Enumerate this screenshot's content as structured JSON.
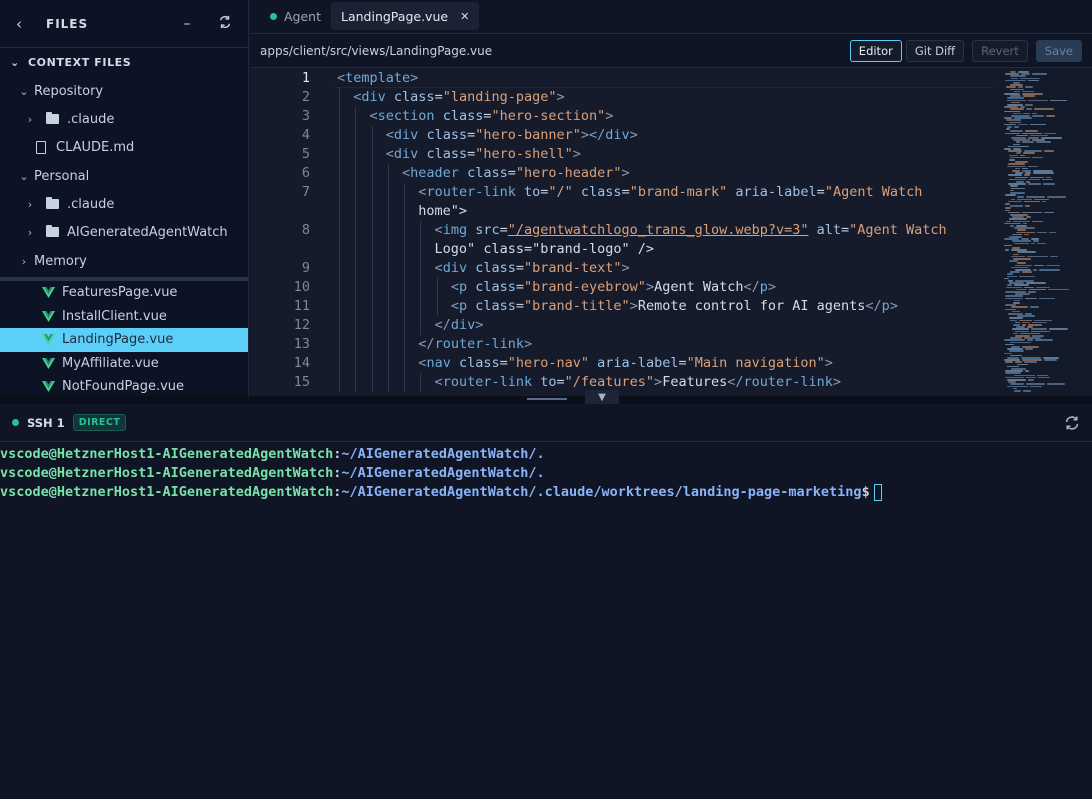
{
  "sidebar": {
    "title": "FILES",
    "back_icon": "chevron-left-icon",
    "collapse_icon": "minus-icon",
    "refresh_icon": "refresh-icon",
    "context_files_label": "CONTEXT FILES",
    "repository_label": "Repository",
    "repository_items": [
      {
        "type": "folder",
        "label": ".claude"
      },
      {
        "type": "file",
        "label": "CLAUDE.md"
      }
    ],
    "personal_label": "Personal",
    "personal_items": [
      {
        "type": "folder",
        "label": ".claude"
      },
      {
        "type": "folder",
        "label": "AIGeneratedAgentWatch"
      }
    ],
    "memory_label": "Memory",
    "vue_files": [
      {
        "label": "FeaturesPage.vue",
        "active": false
      },
      {
        "label": "InstallClient.vue",
        "active": false
      },
      {
        "label": "LandingPage.vue",
        "active": true
      },
      {
        "label": "MyAffiliate.vue",
        "active": false
      },
      {
        "label": "NotFoundPage.vue",
        "active": false
      }
    ]
  },
  "tabs": [
    {
      "label": "Agent",
      "active": false
    },
    {
      "label": "LandingPage.vue",
      "active": true
    }
  ],
  "pathbar": {
    "path": "apps/client/src/views/LandingPage.vue",
    "editor_label": "Editor",
    "gitdiff_label": "Git Diff",
    "revert_label": "Revert",
    "save_label": "Save"
  },
  "code": {
    "current_line": 1,
    "lines": [
      {
        "n": "1",
        "t": "<template>"
      },
      {
        "n": "2",
        "t": "  <div class=\"landing-page\">"
      },
      {
        "n": "3",
        "t": "    <section class=\"hero-section\">"
      },
      {
        "n": "4",
        "t": "      <div class=\"hero-banner\"></div>"
      },
      {
        "n": "5",
        "t": "      <div class=\"hero-shell\">"
      },
      {
        "n": "6",
        "t": "        <header class=\"hero-header\">"
      },
      {
        "n": "7",
        "t": "          <router-link to=\"/\" class=\"brand-mark\" aria-label=\"Agent Watch"
      },
      {
        "n": "",
        "t": "home\">"
      },
      {
        "n": "8",
        "t": "            <img src=\"/agentwatchlogo_trans_glow.webp?v=3\" alt=\"Agent Watch"
      },
      {
        "n": "",
        "t": "  Logo\" class=\"brand-logo\" />"
      },
      {
        "n": "9",
        "t": "            <div class=\"brand-text\">"
      },
      {
        "n": "10",
        "t": "              <p class=\"brand-eyebrow\">Agent Watch</p>"
      },
      {
        "n": "11",
        "t": "              <p class=\"brand-title\">Remote control for AI agents</p>"
      },
      {
        "n": "12",
        "t": "            </div>"
      },
      {
        "n": "13",
        "t": "          </router-link>"
      },
      {
        "n": "14",
        "t": "          <nav class=\"hero-nav\" aria-label=\"Main navigation\">"
      },
      {
        "n": "15",
        "t": "            <router-link to=\"/features\">Features</router-link>"
      }
    ]
  },
  "terminal": {
    "session_name": "SSH 1",
    "badge": "DIRECT",
    "refresh_icon": "refresh-icon",
    "lines": [
      {
        "user": "vscode@HetznerHost1-AIGeneratedAgentWatch",
        "sep": ":",
        "path": "~/AIGeneratedAgentWatch/.",
        "prompt": ""
      },
      {
        "user": "vscode@HetznerHost1-AIGeneratedAgentWatch",
        "sep": ":",
        "path": "~/AIGeneratedAgentWatch/.",
        "prompt": ""
      },
      {
        "user": "vscode@HetznerHost1-AIGeneratedAgentWatch",
        "sep": ":",
        "path": "~/AIGeneratedAgentWatch/.claude/worktrees/landing-page-marketing",
        "prompt": "$"
      }
    ]
  },
  "colors": {
    "accent": "#5ccff8",
    "status_green": "#26c28f",
    "background": "#0f1525"
  }
}
